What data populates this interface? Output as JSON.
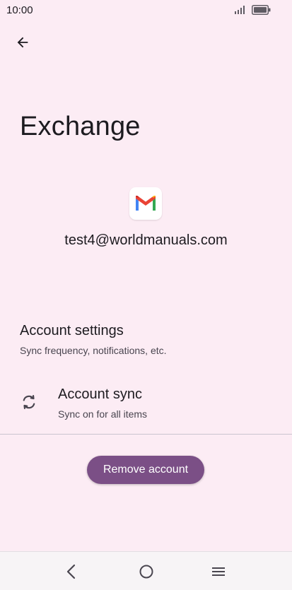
{
  "status_bar": {
    "time": "10:00",
    "icons": [
      "signal-icon",
      "battery-icon"
    ]
  },
  "header": {
    "back_icon": "arrow-left-icon"
  },
  "page": {
    "title": "Exchange",
    "app_icon": "gmail-icon",
    "account_email": "test4@worldmanuals.com"
  },
  "items": {
    "account_settings": {
      "title": "Account settings",
      "subtitle": "Sync frequency, notifications, etc."
    },
    "account_sync": {
      "icon": "sync-icon",
      "title": "Account sync",
      "subtitle": "Sync on for all items"
    }
  },
  "actions": {
    "remove_label": "Remove account"
  },
  "nav_bar": {
    "icons": [
      "back-nav-icon",
      "home-nav-icon",
      "menu-nav-icon"
    ]
  },
  "colors": {
    "background": "#fcecf4",
    "accent": "#7b4f86",
    "text_primary": "#1d1b20",
    "text_secondary": "#49454f",
    "gmail_red": "#ea4335",
    "gmail_blue": "#4285f4",
    "gmail_green": "#34a853",
    "gmail_yellow": "#fbbc04"
  }
}
